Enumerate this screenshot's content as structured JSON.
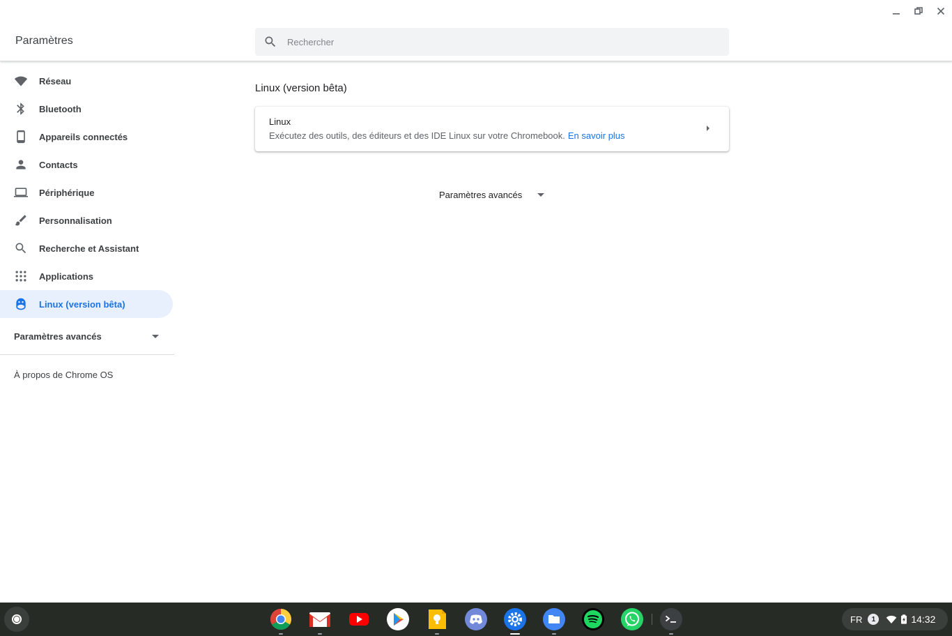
{
  "window": {
    "minimize_icon": "minimize-icon",
    "maximize_icon": "restore-icon",
    "close_icon": "close-icon"
  },
  "header": {
    "title": "Paramètres",
    "search_placeholder": "Rechercher"
  },
  "sidebar": {
    "items": [
      {
        "label": "Réseau",
        "icon": "wifi-icon"
      },
      {
        "label": "Bluetooth",
        "icon": "bluetooth-icon"
      },
      {
        "label": "Appareils connectés",
        "icon": "phone-icon"
      },
      {
        "label": "Contacts",
        "icon": "person-icon"
      },
      {
        "label": "Périphérique",
        "icon": "laptop-icon"
      },
      {
        "label": "Personnalisation",
        "icon": "brush-icon"
      },
      {
        "label": "Recherche et Assistant",
        "icon": "search-icon"
      },
      {
        "label": "Applications",
        "icon": "apps-grid-icon"
      },
      {
        "label": "Linux (version bêta)",
        "icon": "linux-penguin-icon",
        "active": true
      }
    ],
    "advanced_label": "Paramètres avancés",
    "about_label": "À propos de Chrome OS"
  },
  "main": {
    "section_title": "Linux (version bêta)",
    "card": {
      "title": "Linux",
      "description": "Exécutez des outils, des éditeurs et des IDE Linux sur votre Chromebook.",
      "link": "En savoir plus"
    },
    "advanced_label": "Paramètres avancés"
  },
  "shelf": {
    "apps": [
      {
        "name": "chrome",
        "icon": "chrome-icon",
        "open": true
      },
      {
        "name": "gmail",
        "icon": "gmail-icon",
        "open": true
      },
      {
        "name": "youtube",
        "icon": "youtube-icon",
        "open": false
      },
      {
        "name": "play-store",
        "icon": "play-store-icon",
        "open": false
      },
      {
        "name": "keep",
        "icon": "keep-icon",
        "open": true
      },
      {
        "name": "discord",
        "icon": "discord-icon",
        "open": false
      },
      {
        "name": "settings",
        "icon": "settings-icon",
        "open": true,
        "active": true
      },
      {
        "name": "files",
        "icon": "files-icon",
        "open": true
      },
      {
        "name": "spotify",
        "icon": "spotify-icon",
        "open": false
      },
      {
        "name": "whatsapp",
        "icon": "whatsapp-icon",
        "open": false
      },
      {
        "name": "terminal",
        "icon": "terminal-icon",
        "open": true
      }
    ],
    "tray": {
      "language": "FR",
      "notification_count": "1",
      "time": "14:32"
    }
  },
  "colors": {
    "accent": "#1a73e8",
    "active_bg": "#e8f0fe",
    "shelf_bg": "#262b26"
  }
}
